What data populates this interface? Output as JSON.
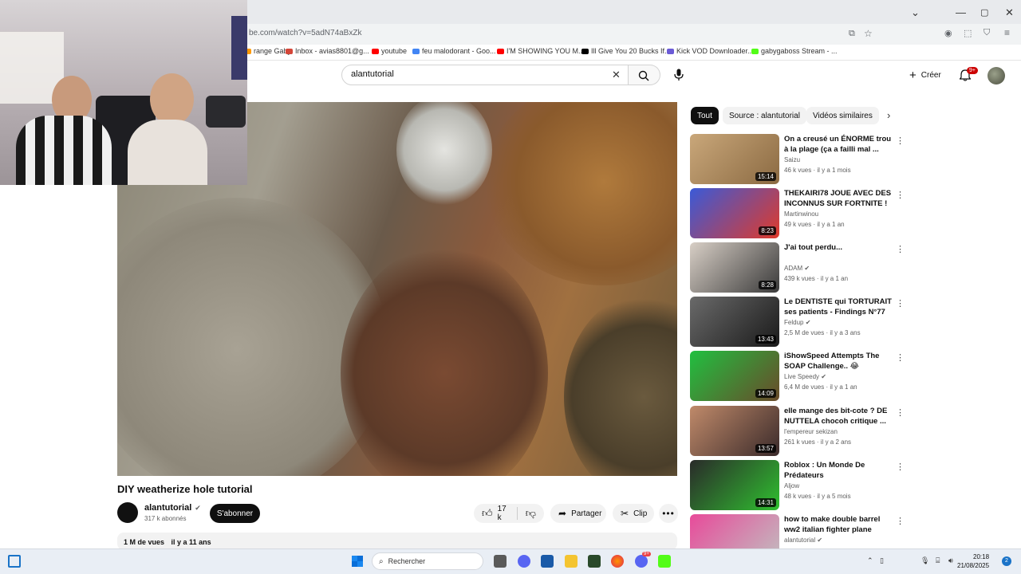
{
  "browser": {
    "url": "be.com/watch?v=5adN74aBxZk",
    "bookmarks": [
      {
        "label": "range Gaby",
        "color": "#ff9900"
      },
      {
        "label": "Inbox - avias8801@g...",
        "color": "#d44638"
      },
      {
        "label": "youtube",
        "color": "#ff0000"
      },
      {
        "label": "feu malodorant - Goo...",
        "color": "#4285f4"
      },
      {
        "label": "I'M SHOWING YOU M...",
        "color": "#ff0000"
      },
      {
        "label": "Ill Give You 20 Bucks If...",
        "color": "#000000"
      },
      {
        "label": "Kick VOD Downloader...",
        "color": "#6b5bd6"
      },
      {
        "label": "gabygaboss Stream - ...",
        "color": "#53fc18"
      }
    ]
  },
  "header": {
    "search_query": "alantutorial",
    "create_label": "Créer",
    "notification_count": "9+"
  },
  "video": {
    "title": "DIY weatherize hole tutorial",
    "channel": "alantutorial",
    "subscribers": "317 k abonnés",
    "subscribe_label": "S'abonner",
    "likes": "17 k",
    "share_label": "Partager",
    "clip_label": "Clip",
    "views": "1 M de vues",
    "age": "il y a 11 ans"
  },
  "chips": [
    "Tout",
    "Source : alantutorial",
    "Vidéos similaires"
  ],
  "recommendations": [
    {
      "title": "On a creusé un ÉNORME trou à la plage (ça a failli mal ...",
      "channel": "Saizu",
      "meta": "46 k vues · il y a 1 mois",
      "duration": "15:14",
      "verified": false,
      "colors": [
        "#c9a77a",
        "#8b6a42"
      ]
    },
    {
      "title": "THEKAIRI78 JOUE AVEC DES INCONNUS SUR FORTNITE ! 😂",
      "channel": "Martinwinou",
      "meta": "49 k vues · il y a 1 an",
      "duration": "8:23",
      "verified": false,
      "colors": [
        "#3a5ad8",
        "#e03a2a"
      ]
    },
    {
      "title": "J'ai tout perdu...",
      "channel": "ADAM",
      "meta": "439 k vues · il y a 1 an",
      "duration": "8:28",
      "verified": true,
      "colors": [
        "#d8cfc6",
        "#3a3a3a"
      ]
    },
    {
      "title": "Le DENTISTE qui TORTURAIT ses patients - Findings N°77",
      "channel": "Feldup",
      "meta": "2,5 M de vues · il y a 3 ans",
      "duration": "13:43",
      "verified": true,
      "colors": [
        "#6a6a6a",
        "#1a1a1a"
      ]
    },
    {
      "title": "iShowSpeed Attempts The SOAP Challenge.. 😂",
      "channel": "Live Speedy",
      "meta": "6,4 M de vues · il y a 1 an",
      "duration": "14:09",
      "verified": true,
      "colors": [
        "#20c040",
        "#6a4a2a"
      ]
    },
    {
      "title": "elle mange des bit-cote ? DE NUTTELA  chocoh critique ...",
      "channel": "l'empereur sekizan",
      "meta": "261 k vues · il y a 2 ans",
      "duration": "13:57",
      "verified": false,
      "colors": [
        "#c08a6a",
        "#3a2a2a"
      ]
    },
    {
      "title": "Roblox : Un Monde De Prédateurs",
      "channel": "Aljow",
      "meta": "48 k vues · il y a 5 mois",
      "duration": "14:31",
      "verified": false,
      "colors": [
        "#2a2a2a",
        "#30c030"
      ]
    },
    {
      "title": "how to make double barrel ww2 italian fighter plane origami ...",
      "channel": "alantutorial",
      "meta": "",
      "duration": "",
      "verified": true,
      "colors": [
        "#e84a9a",
        "#c0c0c0"
      ]
    }
  ],
  "taskbar": {
    "search_placeholder": "Rechercher",
    "time": "20:18",
    "date": "21/08/2025",
    "discord_badge": "9+"
  }
}
